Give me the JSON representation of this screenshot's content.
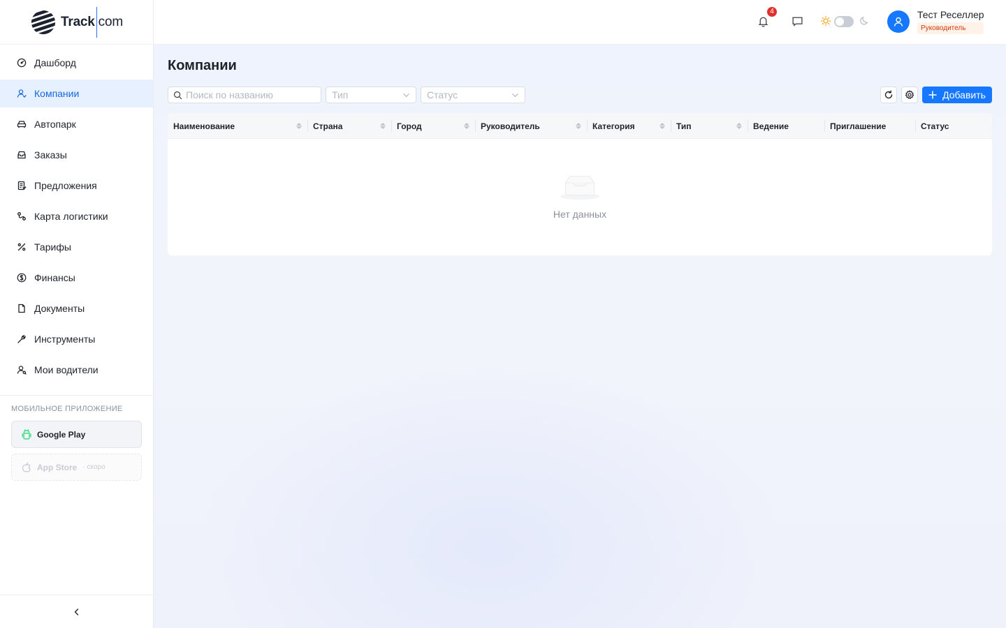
{
  "brand": {
    "name_part1": "Track",
    "name_part2": "com"
  },
  "sidebar": {
    "items": [
      {
        "label": "Дашборд",
        "icon": "dashboard-icon"
      },
      {
        "label": "Компании",
        "icon": "companies-icon",
        "active": true
      },
      {
        "label": "Автопарк",
        "icon": "car-icon"
      },
      {
        "label": "Заказы",
        "icon": "inbox-icon"
      },
      {
        "label": "Предложения",
        "icon": "offer-icon"
      },
      {
        "label": "Карта логистики",
        "icon": "route-icon"
      },
      {
        "label": "Тарифы",
        "icon": "percent-icon"
      },
      {
        "label": "Финансы",
        "icon": "dollar-icon"
      },
      {
        "label": "Документы",
        "icon": "document-icon"
      },
      {
        "label": "Инструменты",
        "icon": "tool-icon"
      },
      {
        "label": "Мои водители",
        "icon": "driver-icon"
      }
    ],
    "mobile_title": "МОБИЛЬНОЕ ПРИЛОЖЕНИЕ",
    "google_play": "Google Play",
    "app_store": "App Store",
    "app_store_note": "· скоро"
  },
  "header": {
    "notifications_count": "4",
    "user_name": "Тест Реселлер",
    "user_role": "Руководитель"
  },
  "page": {
    "title": "Компании",
    "search_placeholder": "Поиск по названию",
    "type_placeholder": "Тип",
    "status_placeholder": "Статус",
    "add_label": "Добавить"
  },
  "table": {
    "columns": [
      {
        "label": "Наименование",
        "sortable": true
      },
      {
        "label": "Страна",
        "sortable": true
      },
      {
        "label": "Город",
        "sortable": true
      },
      {
        "label": "Руководитель",
        "sortable": true
      },
      {
        "label": "Категория",
        "sortable": true
      },
      {
        "label": "Тип",
        "sortable": true
      },
      {
        "label": "Ведение",
        "sortable": false
      },
      {
        "label": "Приглашение",
        "sortable": false
      },
      {
        "label": "Статус",
        "sortable": false
      }
    ],
    "empty_text": "Нет данных"
  },
  "colors": {
    "accent": "#1677ff",
    "active_bg": "#e6f0ff",
    "badge": "#e03131",
    "role_text": "#d4380d",
    "role_bg": "#fff2e8"
  }
}
